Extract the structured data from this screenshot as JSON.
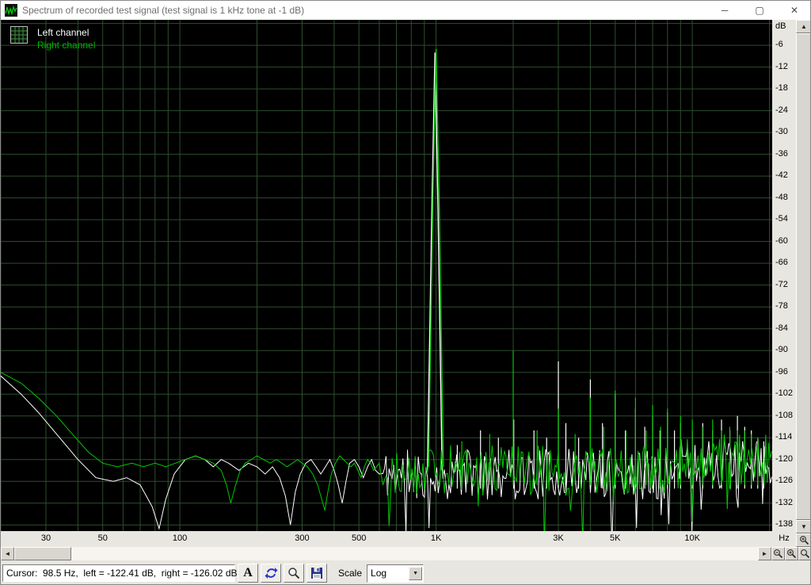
{
  "window": {
    "title": "Spectrum of recorded test signal (test signal is 1 kHz tone at -1 dB)",
    "minimize_glyph": "─",
    "maximize_glyph": "▢",
    "close_glyph": "✕"
  },
  "legend": {
    "items": [
      {
        "label": "Left channel",
        "color": "#ffffff"
      },
      {
        "label": "Right channel",
        "color": "#00b400"
      }
    ]
  },
  "axes": {
    "x_unit": "Hz",
    "y_unit": "dB",
    "x_ticks": [
      {
        "f": 30,
        "label": "30"
      },
      {
        "f": 50,
        "label": "50"
      },
      {
        "f": 100,
        "label": "100"
      },
      {
        "f": 300,
        "label": "300"
      },
      {
        "f": 500,
        "label": "500"
      },
      {
        "f": 1000,
        "label": "1K"
      },
      {
        "f": 3000,
        "label": "3K"
      },
      {
        "f": 5000,
        "label": "5K"
      },
      {
        "f": 10000,
        "label": "10K"
      }
    ],
    "y_tick_start": -6,
    "y_tick_end": -138,
    "y_tick_step": 6
  },
  "chart_data": {
    "type": "line",
    "title": "Spectrum of recorded test signal (test signal is 1 kHz tone at -1 dB)",
    "x_axis": {
      "scale": "log",
      "min_hz": 20,
      "max_hz": 20500,
      "unit": "Hz"
    },
    "y_axis": {
      "unit": "dB",
      "top_db": 1,
      "bottom_db": -139.7,
      "grid_step_db": 6
    },
    "grid_color": "#2e4d2e",
    "background": "#000000",
    "series": [
      {
        "name": "Left channel",
        "color": "#ffffff",
        "envelope_db": [
          [
            20,
            -97
          ],
          [
            24,
            -102
          ],
          [
            28,
            -107
          ],
          [
            33,
            -113
          ],
          [
            40,
            -120
          ],
          [
            47,
            -125
          ],
          [
            55,
            -126
          ],
          [
            62,
            -125
          ],
          [
            70,
            -127
          ],
          [
            78,
            -133
          ],
          [
            83,
            -139
          ],
          [
            88,
            -131
          ],
          [
            95,
            -124
          ],
          [
            105,
            -120
          ],
          [
            115,
            -119
          ],
          [
            125,
            -120
          ],
          [
            135,
            -122
          ],
          [
            145,
            -120
          ],
          [
            155,
            -121
          ],
          [
            170,
            -123
          ],
          [
            185,
            -121
          ],
          [
            200,
            -122
          ],
          [
            215,
            -124
          ],
          [
            230,
            -122
          ],
          [
            245,
            -125
          ],
          [
            258,
            -130
          ],
          [
            270,
            -138
          ],
          [
            282,
            -129
          ],
          [
            295,
            -124
          ],
          [
            310,
            -121
          ],
          [
            325,
            -120
          ],
          [
            340,
            -122
          ],
          [
            355,
            -124
          ],
          [
            370,
            -122
          ],
          [
            385,
            -120
          ],
          [
            400,
            -123
          ],
          [
            415,
            -127
          ],
          [
            430,
            -132
          ],
          [
            445,
            -126
          ],
          [
            460,
            -121
          ],
          [
            480,
            -120
          ],
          [
            500,
            -122
          ],
          [
            520,
            -125
          ],
          [
            540,
            -122
          ],
          [
            560,
            -120
          ],
          [
            580,
            -123
          ],
          [
            600,
            -124
          ]
        ],
        "peak_db": [
          [
            925,
            -123
          ],
          [
            962,
            -52
          ],
          [
            990,
            -8
          ],
          [
            1018,
            -52
          ],
          [
            1055,
            -123
          ]
        ],
        "harmonics_db": [
          [
            1210,
            -116
          ],
          [
            1490,
            -112
          ],
          [
            1750,
            -114
          ],
          [
            2010,
            -109
          ],
          [
            2410,
            -112
          ],
          [
            2700,
            -114
          ],
          [
            3000,
            -93
          ],
          [
            3210,
            -110
          ],
          [
            3600,
            -114
          ],
          [
            4000,
            -98
          ],
          [
            4460,
            -110
          ],
          [
            5000,
            -102
          ],
          [
            5480,
            -112
          ],
          [
            6000,
            -106
          ],
          [
            6520,
            -111
          ],
          [
            7000,
            -108
          ],
          [
            7480,
            -112
          ],
          [
            8000,
            -107
          ],
          [
            8520,
            -112
          ],
          [
            9000,
            -110
          ],
          [
            10000,
            -112
          ],
          [
            10980,
            -110
          ],
          [
            12000,
            -112
          ],
          [
            13000,
            -109
          ],
          [
            14020,
            -112
          ],
          [
            15000,
            -108
          ],
          [
            16010,
            -111
          ],
          [
            17000,
            -112
          ],
          [
            18000,
            -114
          ],
          [
            19000,
            -115
          ]
        ],
        "noise": {
          "from_hz": 620,
          "to_hz": 20500,
          "floor_db": -124,
          "jitter_db": 7,
          "hi_from_hz": 9000,
          "floor_hi_db": -121,
          "notch_chance": 0.06,
          "notch_extra_db": 12,
          "seed": 11
        }
      },
      {
        "name": "Right channel",
        "color": "#00c800",
        "envelope_db": [
          [
            20,
            -96
          ],
          [
            24,
            -99
          ],
          [
            28,
            -103
          ],
          [
            33,
            -108
          ],
          [
            38,
            -113
          ],
          [
            44,
            -118
          ],
          [
            50,
            -121
          ],
          [
            57,
            -122
          ],
          [
            65,
            -121
          ],
          [
            72,
            -122
          ],
          [
            80,
            -121
          ],
          [
            88,
            -122
          ],
          [
            96,
            -121
          ],
          [
            105,
            -120
          ],
          [
            115,
            -119
          ],
          [
            125,
            -120
          ],
          [
            135,
            -121
          ],
          [
            145,
            -123
          ],
          [
            152,
            -127
          ],
          [
            158,
            -132
          ],
          [
            165,
            -127
          ],
          [
            172,
            -123
          ],
          [
            180,
            -121
          ],
          [
            190,
            -120
          ],
          [
            200,
            -119
          ],
          [
            212,
            -120
          ],
          [
            225,
            -121
          ],
          [
            238,
            -120
          ],
          [
            250,
            -121
          ],
          [
            262,
            -122
          ],
          [
            275,
            -121
          ],
          [
            288,
            -120
          ],
          [
            300,
            -121
          ],
          [
            315,
            -122
          ],
          [
            330,
            -124
          ],
          [
            345,
            -127
          ],
          [
            358,
            -131
          ],
          [
            368,
            -134
          ],
          [
            378,
            -129
          ],
          [
            390,
            -124
          ],
          [
            405,
            -121
          ],
          [
            420,
            -119
          ],
          [
            435,
            -120
          ],
          [
            450,
            -121
          ],
          [
            465,
            -122
          ],
          [
            480,
            -121
          ],
          [
            495,
            -123
          ],
          [
            510,
            -125
          ],
          [
            525,
            -122
          ],
          [
            540,
            -120
          ],
          [
            555,
            -121
          ],
          [
            570,
            -123
          ],
          [
            585,
            -122
          ],
          [
            600,
            -121
          ]
        ],
        "peak_db": [
          [
            935,
            -122
          ],
          [
            972,
            -48
          ],
          [
            1000,
            -7
          ],
          [
            1028,
            -48
          ],
          [
            1068,
            -122
          ]
        ],
        "harmonics_db": [
          [
            1260,
            -115
          ],
          [
            1620,
            -113
          ],
          [
            2000,
            -90
          ],
          [
            2480,
            -112
          ],
          [
            3000,
            -106
          ],
          [
            3490,
            -113
          ],
          [
            4000,
            -103
          ],
          [
            4510,
            -111
          ],
          [
            5000,
            -101
          ],
          [
            5510,
            -112
          ],
          [
            6000,
            -103
          ],
          [
            6610,
            -112
          ],
          [
            7000,
            -105
          ],
          [
            7520,
            -111
          ],
          [
            8000,
            -106
          ],
          [
            9000,
            -108
          ],
          [
            10000,
            -109
          ],
          [
            11010,
            -111
          ],
          [
            12000,
            -109
          ],
          [
            13010,
            -112
          ],
          [
            14000,
            -111
          ],
          [
            15020,
            -112
          ],
          [
            16000,
            -112
          ],
          [
            17010,
            -113
          ],
          [
            18000,
            -114
          ]
        ],
        "noise": {
          "from_hz": 620,
          "to_hz": 20500,
          "floor_db": -123,
          "jitter_db": 7,
          "hi_from_hz": 9000,
          "floor_hi_db": -120,
          "notch_chance": 0.06,
          "notch_extra_db": 12,
          "seed": 29
        }
      }
    ]
  },
  "scrollbars": {
    "up_glyph": "▲",
    "down_glyph": "▼",
    "left_glyph": "◄",
    "right_glyph": "►"
  },
  "statusbar": {
    "cursor_text": "Cursor:  98.5 Hz,  left = -122.41 dB,  right = -126.02 dB",
    "font_button_label": "A",
    "scale_label": "Scale",
    "scale_value": "Log",
    "scale_dropdown_glyph": "▼"
  }
}
